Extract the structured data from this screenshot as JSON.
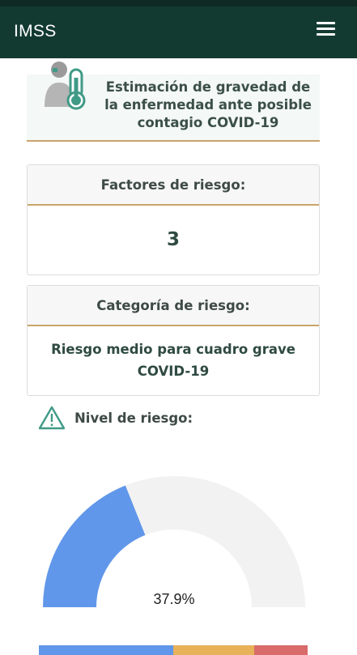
{
  "app": {
    "title": "IMSS"
  },
  "header": {
    "menu_icon": "hamburger-menu-icon"
  },
  "hero": {
    "title": "Estimación de gravedad de la enfermedad ante posible contagio COVID-19",
    "icon": "person-thermometer-icon"
  },
  "risk_factors": {
    "label": "Factores de riesgo:",
    "value": "3"
  },
  "risk_category": {
    "label": "Categoría de riesgo:",
    "value": "Riesgo medio para cuadro grave COVID-19"
  },
  "risk_level": {
    "label": "Nivel de riesgo:",
    "icon": "warning-triangle-icon",
    "value_text": "37.9%",
    "value": 0.379
  },
  "colors": {
    "brand_dark": "#133a31",
    "accent_gold": "#c9a46a",
    "gauge_fill": "#6197ea",
    "gauge_track": "#f2f2f2",
    "scale_low": "#6197ea",
    "scale_mid": "#e7b25a",
    "scale_high": "#d96b6b",
    "icon_teal": "#3f9a86"
  },
  "scale": [
    {
      "name": "low",
      "fraction": 0.5
    },
    {
      "name": "medium",
      "fraction": 0.3
    },
    {
      "name": "high",
      "fraction": 0.2
    }
  ]
}
